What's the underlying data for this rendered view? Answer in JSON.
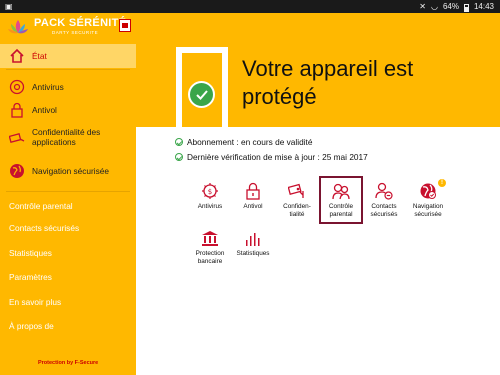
{
  "statusbar": {
    "battery": "64%",
    "time": "14:43"
  },
  "brand": {
    "title": "PACK SÉRÉNITÉ",
    "subtitle": "DARTY SECURITE"
  },
  "sidebar": {
    "nav": [
      {
        "label": "État",
        "icon": "home-icon",
        "active": true
      },
      {
        "label": "Antivirus",
        "icon": "virus-icon"
      },
      {
        "label": "Antivol",
        "icon": "lock-icon"
      },
      {
        "label": "Confidentialité des applications",
        "icon": "camera-icon"
      },
      {
        "label": "Navigation sécurisée",
        "icon": "globe-icon"
      }
    ],
    "links": [
      "Contrôle parental",
      "Contacts sécurisés",
      "Statistiques",
      "Paramètres",
      "En savoir plus",
      "À propos de"
    ],
    "protection": "Protection by F-Secure"
  },
  "hero": {
    "title": "Votre appareil est protégé"
  },
  "status": {
    "subscription": "Abonnement : en cours de validité",
    "update": "Dernière vérification de mise à jour : 25 mai 2017"
  },
  "tiles": [
    {
      "label": "Antivirus",
      "icon": "virus-icon"
    },
    {
      "label": "Antivol",
      "icon": "lock-icon"
    },
    {
      "label": "Confiden-\ntialité",
      "icon": "camera-icon"
    },
    {
      "label": "Contrôle\nparental",
      "icon": "family-icon",
      "selected": true
    },
    {
      "label": "Contacts\nsécurisés",
      "icon": "contacts-icon"
    },
    {
      "label": "Navigation\nsécurisée",
      "icon": "globe-icon",
      "badge": "!"
    },
    {
      "label": "Protection\nbancaire",
      "icon": "bank-icon"
    },
    {
      "label": "Statistiques",
      "icon": "stats-icon"
    }
  ],
  "colors": {
    "accent": "#ffb800",
    "icon_red": "#c8102e",
    "ok_green": "#3aa54a",
    "selected_border": "#7a1430"
  }
}
